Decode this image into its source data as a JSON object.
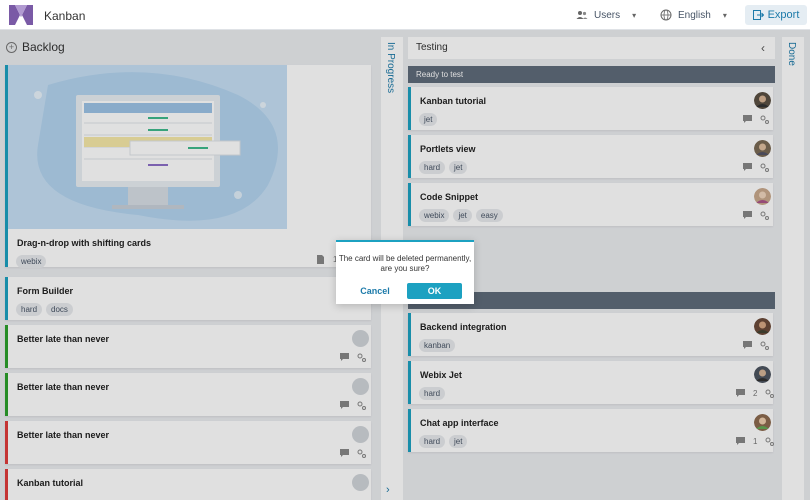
{
  "header": {
    "app_title": "Kanban",
    "users_label": "Users",
    "language_label": "English",
    "export_label": "Export"
  },
  "columns": {
    "backlog": "Backlog",
    "in_progress": "In Progress",
    "testing": "Testing",
    "done": "Done"
  },
  "groups": {
    "ready_to_test": "Ready to test"
  },
  "backlog_cards": [
    {
      "title": "Drag-n-drop with shifting cards",
      "tags": [
        "webix"
      ],
      "attachments": "1",
      "color": "#1ca1c1"
    },
    {
      "title": "Form Builder",
      "tags": [
        "hard",
        "docs"
      ],
      "color": "#1ca1c1"
    },
    {
      "title": "Better late than never",
      "tags": [],
      "color": "#2ca02c"
    },
    {
      "title": "Better late than never",
      "tags": [],
      "color": "#2ca02c"
    },
    {
      "title": "Better late than never",
      "tags": [],
      "color": "#e03c3c"
    },
    {
      "title": "Kanban tutorial",
      "tags": [],
      "color": "#e03c3c"
    }
  ],
  "testing_cards": [
    {
      "title": "Kanban tutorial",
      "tags": [
        "jet"
      ]
    },
    {
      "title": "Portlets view",
      "tags": [
        "hard",
        "jet"
      ]
    },
    {
      "title": "Code Snippet",
      "tags": [
        "webix",
        "jet",
        "easy"
      ]
    },
    {
      "title": "Backend integration",
      "tags": [
        "kanban"
      ]
    },
    {
      "title": "Webix Jet",
      "tags": [
        "hard"
      ],
      "comments": "2"
    },
    {
      "title": "Chat app interface",
      "tags": [
        "hard",
        "jet"
      ],
      "comments": "1"
    }
  ],
  "dialog": {
    "message": "The card will be deleted permanently, are you sure?",
    "cancel_label": "Cancel",
    "ok_label": "OK"
  },
  "colors": {
    "accent": "#1ca1c1",
    "group_header": "#5f6b7a",
    "overlay": "rgba(0,0,0,0.12)"
  }
}
